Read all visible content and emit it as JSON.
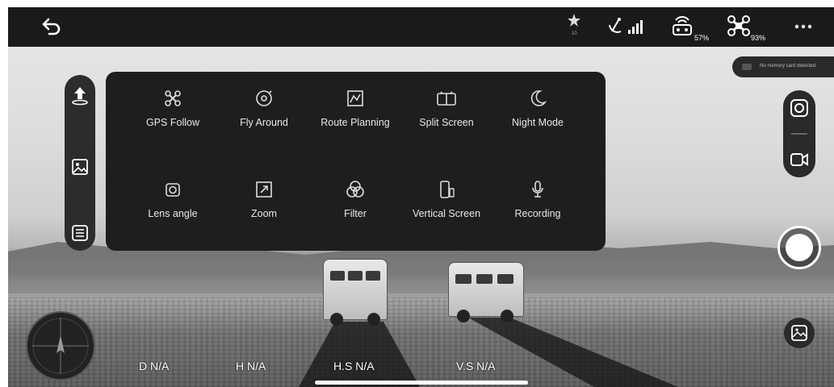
{
  "topbar": {
    "back_icon": "back-arrow-icon",
    "satellite_count": "10",
    "remote_battery": "57%",
    "drone_battery": "93%",
    "more_icon": "more-dots-icon"
  },
  "notice": {
    "memory_card": "No memory card detected"
  },
  "menu": {
    "items": [
      {
        "label": "GPS Follow",
        "icon": "gps-follow-icon"
      },
      {
        "label": "Fly Around",
        "icon": "fly-around-icon"
      },
      {
        "label": "Route Planning",
        "icon": "route-planning-icon"
      },
      {
        "label": "Split Screen",
        "icon": "split-screen-icon"
      },
      {
        "label": "Night Mode",
        "icon": "night-mode-icon"
      },
      {
        "label": "Lens angle",
        "icon": "lens-angle-icon"
      },
      {
        "label": "Zoom",
        "icon": "zoom-icon"
      },
      {
        "label": "Filter",
        "icon": "filter-icon"
      },
      {
        "label": "Vertical Screen",
        "icon": "vertical-screen-icon"
      },
      {
        "label": "Recording",
        "icon": "recording-icon"
      }
    ]
  },
  "telemetry": {
    "distance": "D N/A",
    "height": "H N/A",
    "horizontal_speed": "H.S N/A",
    "vertical_speed": "V.S N/A"
  },
  "colors": {
    "panel": "#1e1e1e",
    "topbar": "#1a1a1a",
    "text": "#e8e8e8"
  }
}
